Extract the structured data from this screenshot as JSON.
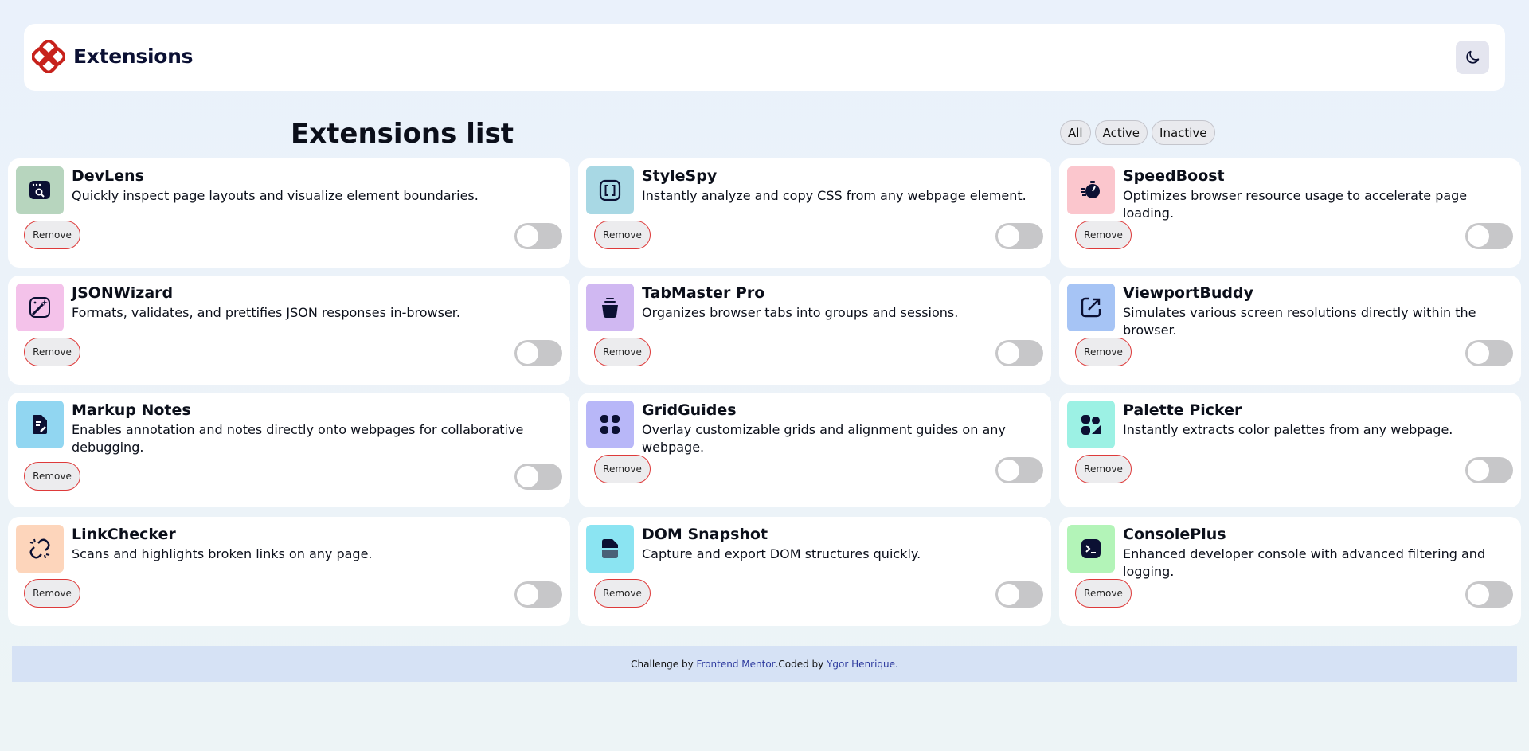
{
  "header": {
    "logo_text": "Extensions",
    "theme_icon": "moon-icon"
  },
  "title": "Extensions list",
  "filters": [
    "All",
    "Active",
    "Inactive"
  ],
  "remove_label": "Remove",
  "extensions": [
    {
      "name": "DevLens",
      "description": "Quickly inspect page layouts and visualize element boundaries.",
      "icon": "devlens-icon",
      "icon_bg": "#b7d5be",
      "active": false
    },
    {
      "name": "StyleSpy",
      "description": "Instantly analyze and copy CSS from any webpage element.",
      "icon": "stylespy-icon",
      "icon_bg": "#a8d8e4",
      "active": false
    },
    {
      "name": "SpeedBoost",
      "description": "Optimizes browser resource usage to accelerate page loading.",
      "icon": "speedboost-icon",
      "icon_bg": "#fbc6cd",
      "active": false
    },
    {
      "name": "JSONWizard",
      "description": "Formats, validates, and prettifies JSON responses in-browser.",
      "icon": "jsonwizard-icon",
      "icon_bg": "#f4c2ea",
      "active": false
    },
    {
      "name": "TabMaster Pro",
      "description": "Organizes browser tabs into groups and sessions.",
      "icon": "tabmaster-icon",
      "icon_bg": "#d0b8f2",
      "active": false
    },
    {
      "name": "ViewportBuddy",
      "description": "Simulates various screen resolutions directly within the browser.",
      "icon": "viewportbuddy-icon",
      "icon_bg": "#a6c4f5",
      "active": false
    },
    {
      "name": "Markup Notes",
      "description": "Enables annotation and notes directly onto webpages for collaborative debugging.",
      "icon": "markupnotes-icon",
      "icon_bg": "#91d6f1",
      "active": false
    },
    {
      "name": "GridGuides",
      "description": "Overlay customizable grids and alignment guides on any webpage.",
      "icon": "gridguides-icon",
      "icon_bg": "#b8b7f8",
      "active": false
    },
    {
      "name": "Palette Picker",
      "description": "Instantly extracts color palettes from any webpage.",
      "icon": "palettepicker-icon",
      "icon_bg": "#9cf1e4",
      "active": false
    },
    {
      "name": "LinkChecker",
      "description": "Scans and highlights broken links on any page.",
      "icon": "linkchecker-icon",
      "icon_bg": "#fdd5bb",
      "active": false
    },
    {
      "name": "DOM Snapshot",
      "description": "Capture and export DOM structures quickly.",
      "icon": "domsnapshot-icon",
      "icon_bg": "#8be4f2",
      "active": false
    },
    {
      "name": "ConsolePlus",
      "description": "Enhanced developer console with advanced filtering and logging.",
      "icon": "consoleplus-icon",
      "icon_bg": "#b3f4b8",
      "active": false
    }
  ],
  "footer": {
    "challenge_prefix": "Challenge by ",
    "challenge_link": "Frontend Mentor",
    "coded_prefix": ".Coded by ",
    "author_link": "Ygor Henrique",
    "suffix": "."
  },
  "colors": {
    "accent": "#de3a3a",
    "logo": "#c7221c",
    "toggle_off": "#c7c7c9",
    "footer_bg": "#d6e2f5"
  }
}
